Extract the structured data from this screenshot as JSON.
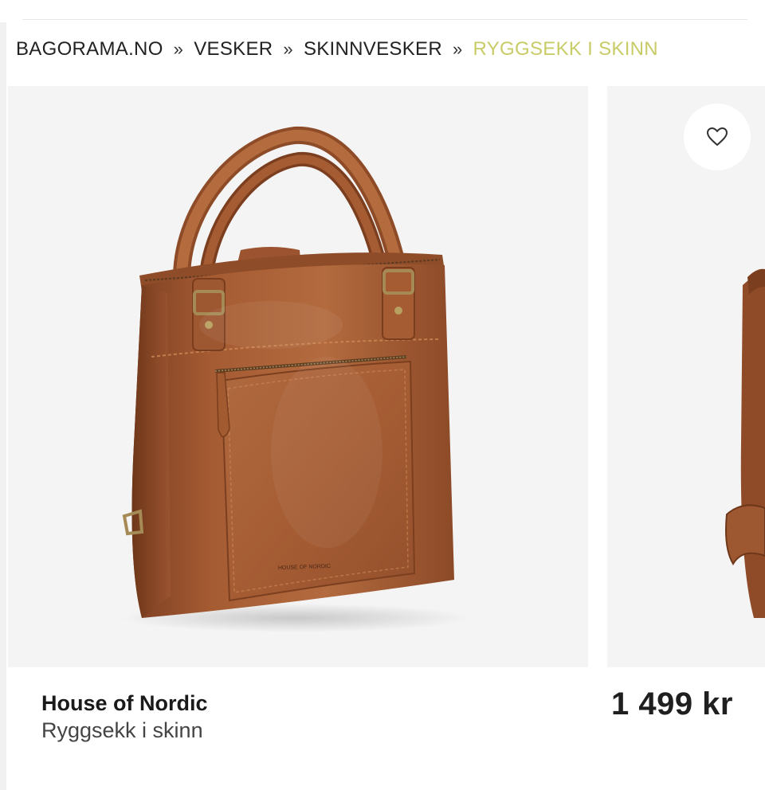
{
  "breadcrumb": {
    "items": [
      "BAGORAMA.NO",
      "VESKER",
      "SKINNVESKER"
    ],
    "separator": "»",
    "current": "RYGGSEKK I SKINN"
  },
  "product": {
    "brand": "House of Nordic",
    "name": "Ryggsekk i skinn",
    "price": "1 499 kr",
    "image": "brown-leather-backpack-tote",
    "logo_text": "HOUSE OF NORDIC"
  },
  "icons": {
    "favorite": "heart-outline-icon"
  },
  "colors": {
    "breadcrumb_current": "#c8cc66",
    "leather": "#a35a32",
    "panel_background": "#f4f4f4"
  }
}
